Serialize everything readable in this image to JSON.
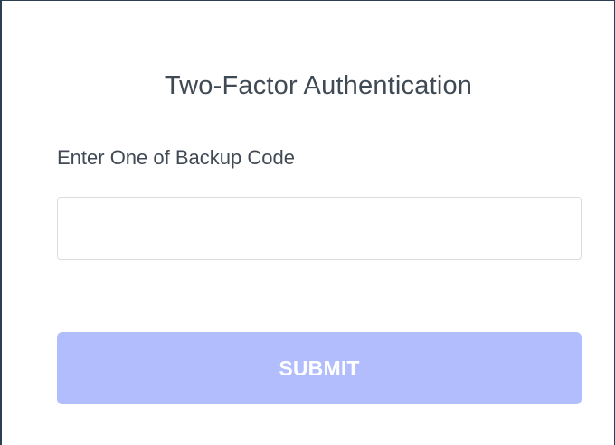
{
  "dialog": {
    "title": "Two-Factor Authentication",
    "backup_code_label": "Enter One of Backup Code",
    "backup_code_value": "",
    "backup_code_placeholder": "",
    "submit_label": "SUBMIT"
  },
  "colors": {
    "submit_background": "#b1bdfd",
    "text": "#404a55",
    "input_border": "#d9dde2"
  }
}
